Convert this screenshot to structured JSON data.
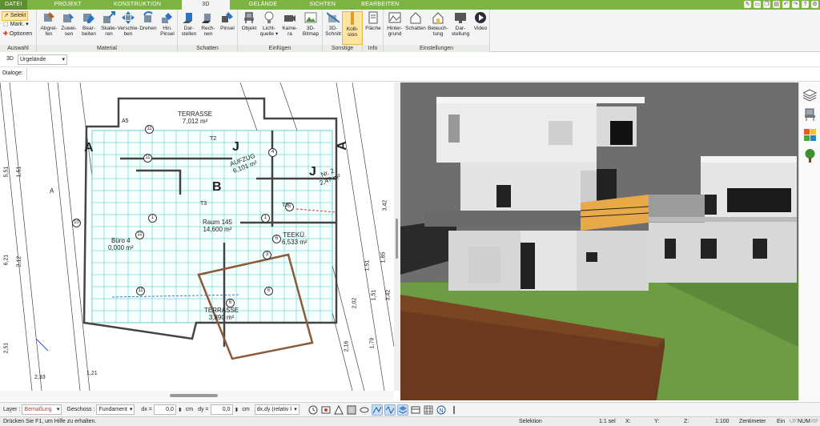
{
  "menubar": {
    "tabs": [
      {
        "label": "DATEI",
        "active": false
      },
      {
        "label": "PROJEKT",
        "active": false
      },
      {
        "label": "KONSTRUKTION",
        "active": false
      },
      {
        "label": "3D",
        "active": true
      },
      {
        "label": "GELÄNDE",
        "active": false
      },
      {
        "label": "SICHTEN",
        "active": false
      },
      {
        "label": "BEARBEITEN",
        "active": false
      }
    ]
  },
  "ribbon": {
    "auswahl": {
      "label": "Auswahl",
      "selekt": "Selekt",
      "mark": "Mark.",
      "optionen": "Optionen"
    },
    "material": {
      "label": "Material",
      "buttons": [
        {
          "line1": "Abgrei-",
          "line2": "fen"
        },
        {
          "line1": "Zuwei-",
          "line2": "sen"
        },
        {
          "line1": "Bear-",
          "line2": "beiten"
        },
        {
          "line1": "Skalie-",
          "line2": "ren"
        },
        {
          "line1": "Verschie-",
          "line2": "ben"
        },
        {
          "line1": "Drehen",
          "line2": ""
        },
        {
          "line1": "Hin.",
          "line2": "Pinsel"
        }
      ]
    },
    "schatten": {
      "label": "Schatten",
      "buttons": [
        {
          "line1": "Dar-",
          "line2": "stellen"
        },
        {
          "line1": "Rech-",
          "line2": "nen"
        },
        {
          "line1": "Pinsel",
          "line2": ""
        }
      ]
    },
    "einfuegen": {
      "label": "Einfügen",
      "buttons": [
        {
          "line1": "Objekt",
          "line2": ""
        },
        {
          "line1": "Licht-",
          "line2": "quelle"
        },
        {
          "line1": "Kame-",
          "line2": "ra"
        },
        {
          "line1": "3D-",
          "line2": "Bitmap"
        }
      ]
    },
    "sonstige": {
      "label": "Sonstige",
      "buttons": [
        {
          "line1": "3D-",
          "line2": "Schnitt"
        },
        {
          "line1": "Kolli-",
          "line2": "sion"
        }
      ]
    },
    "info": {
      "label": "Info",
      "buttons": [
        {
          "line1": "Fläche",
          "line2": ""
        }
      ]
    },
    "einstellungen": {
      "label": "Einstellungen",
      "buttons": [
        {
          "line1": "Hinter-",
          "line2": "grund"
        },
        {
          "line1": "Schatten",
          "line2": ""
        },
        {
          "line1": "Beleuch-",
          "line2": "tung"
        },
        {
          "line1": "Dar-",
          "line2": "stellung"
        },
        {
          "line1": "Video",
          "line2": ""
        }
      ]
    }
  },
  "row3d": {
    "mode": "3D",
    "selection": "Urgelände"
  },
  "dialog": {
    "label": "Dialoge:"
  },
  "plan": {
    "rooms": [
      {
        "name": "TERRASSE",
        "area": "7,012 m²"
      },
      {
        "name": "AUFZUG",
        "area": "6,101 m²"
      },
      {
        "name": "Nr. 2",
        "area": "2,47 m²"
      },
      {
        "name": "Raum 145",
        "area": "14,600 m²"
      },
      {
        "name": "Büro 4",
        "area": "0,000 m²"
      },
      {
        "name": "TEEKÜ.",
        "area": "6,533 m²"
      },
      {
        "name": "TERRASSE",
        "area": "3,890 m²"
      }
    ],
    "dims_left": [
      "5,51",
      "1,51",
      "6,21",
      "2,12",
      "2,51"
    ],
    "dims_right": [
      "3,42",
      "1,51",
      "1,85",
      "1,51",
      "3,42",
      "2,02",
      "1,79",
      "2,16"
    ],
    "dims_bottom": [
      "2,33",
      "1,21"
    ],
    "section_labels": [
      "A",
      "A",
      "B",
      "B",
      "J",
      "J",
      "A",
      "A"
    ],
    "markers": [
      "11",
      "11",
      "1",
      "1",
      "5",
      "6",
      "10",
      "11",
      "11",
      "4",
      "3",
      "6",
      "6"
    ],
    "annot": [
      "A5",
      "T2",
      "T3",
      "T5"
    ]
  },
  "bottombar": {
    "layer_label": "Layer :",
    "layer_value": "Bemaßung",
    "geschoss_label": "Geschoss :",
    "geschoss_value": "Fundament",
    "dx_label": "dx =",
    "dx_value": "0,0",
    "dx_unit": "cm",
    "dy_label": "dy =",
    "dy_value": "0,0",
    "dy_unit": "cm",
    "mode_value": "dx,dy (relativ ka"
  },
  "status": {
    "help": "Drücken Sie F1, um Hilfe zu erhalten.",
    "selektion": "Selektion",
    "sel": "1:1 sel",
    "x": "X:",
    "y": "Y:",
    "z": "Z:",
    "scale": "1:100",
    "unit": "Zentimeter",
    "ein": "Ein",
    "uf": "UF",
    "num": "NUM",
    "rf": "RF"
  },
  "colors": {
    "menubar": "#7cb342",
    "grid": "#41c6c6",
    "plan_wall": "#444444",
    "lawn": "#5c8a3a",
    "soil": "#6b3a1e",
    "terrace": "#e8a948",
    "sky": "#6e6e6e"
  }
}
